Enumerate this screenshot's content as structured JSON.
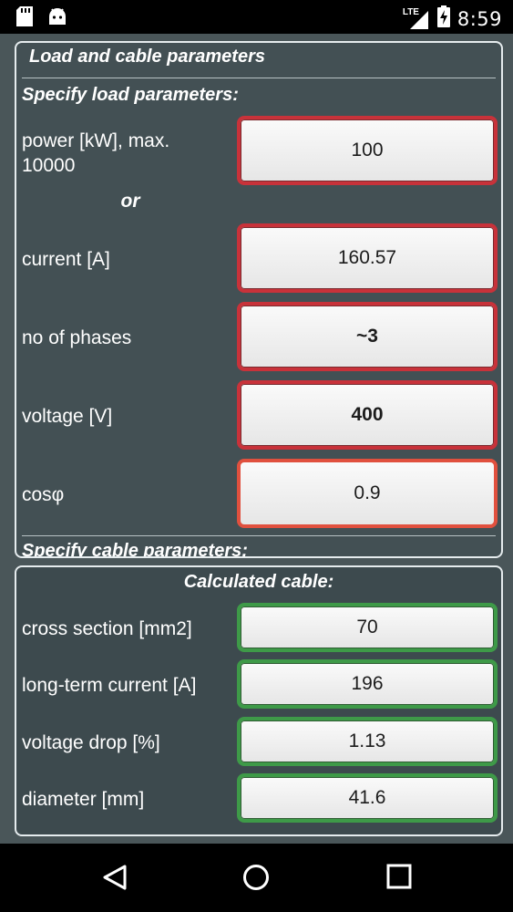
{
  "status_bar": {
    "network": "LTE",
    "time": "8:59",
    "icons": [
      "sd-card-icon",
      "android-icon",
      "signal-icon",
      "battery-charging-icon"
    ]
  },
  "load_panel": {
    "title": "Load and cable parameters",
    "load_heading": "Specify load parameters:",
    "or_label": "or",
    "rows": [
      {
        "label": "power [kW], max. 10000",
        "value": "100"
      },
      {
        "label": "current [A]",
        "value": "160.57"
      },
      {
        "label": "no of phases",
        "value": "~3"
      },
      {
        "label": "voltage [V]",
        "value": "400"
      },
      {
        "label": "cosφ",
        "value": "0.9"
      }
    ],
    "cable_heading": "Specify cable parameters:"
  },
  "result_panel": {
    "title": "Calculated cable:",
    "rows": [
      {
        "label": "cross section [mm2]",
        "value": "70"
      },
      {
        "label": "long-term current [A]",
        "value": "196"
      },
      {
        "label": "voltage drop [%]",
        "value": "1.13"
      },
      {
        "label": "diameter [mm]",
        "value": "41.6"
      }
    ]
  },
  "nav_bar": {
    "icons": [
      "back-icon",
      "home-icon",
      "recents-icon"
    ]
  }
}
